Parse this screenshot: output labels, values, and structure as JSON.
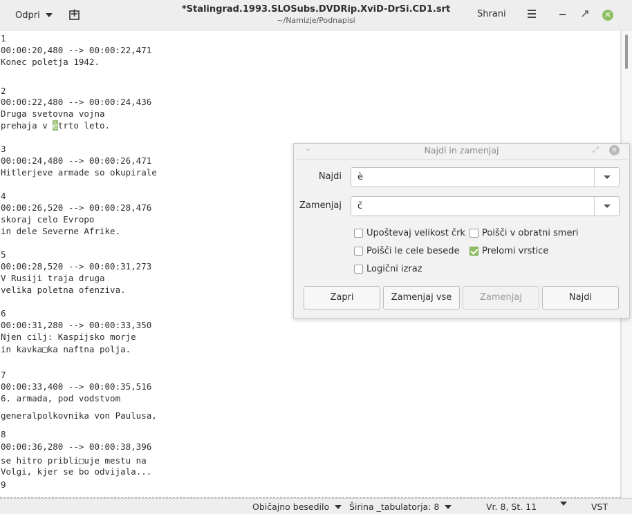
{
  "header": {
    "open_label": "Odpri",
    "title": "*Stalingrad.1993.SLOSubs.DVDRip.XviD-DrSi.CD1.srt",
    "subtitle": "~/Namizje/Podnapisi",
    "save_label": "Shrani",
    "icons": {
      "new_document": "new-document-icon",
      "menu": "hamburger-menu-icon",
      "minimize": "minimize-icon",
      "maximize": "maximize-icon",
      "close": "close-icon"
    }
  },
  "editor": {
    "lines": [
      "1",
      "00:00:20,480 --> 00:00:22,471",
      "Konec poletja 1942.",
      "",
      "2",
      "00:00:22,480 --> 00:00:24,436",
      "Druga svetovna vojna",
      "prehaja v ",
      "",
      "3",
      "00:00:24,480 --> 00:00:26,471",
      "Hitlerjeve armade so okupirale",
      "",
      "4",
      "00:00:26,520 --> 00:00:28,476",
      "skoraj celo Evropo",
      "in dele Severne Afrike.",
      "",
      "5",
      "00:00:28,520 --> 00:00:31,273",
      "V Rusiji traja druga",
      "velika poletna ofenziva.",
      "",
      "6",
      "00:00:31,280 --> 00:00:33,350",
      "Njen cilj: Kaspijsko morje",
      "in kavka",
      "",
      "7",
      "00:00:33,400 --> 00:00:35,516",
      "6. armada, pod vodstvom",
      "generalpolkovnika von Paulusa,",
      "",
      "8",
      "00:00:36,280 --> 00:00:38,396",
      "se hitro pribli",
      "Volgi, kjer se bo odvijala...",
      "",
      "9"
    ],
    "highlight_char": "è",
    "line8_rest": "trto leto.",
    "line27_bad_char": "□",
    "line27_rest": "ka naftna polja.",
    "line36_bad_char": "□",
    "line36_rest": "uje mestu na"
  },
  "statusbar": {
    "language": "Običajno besedilo",
    "tab_width": "Širina _tabulatorja: 8",
    "position": "Vr. 8, St. 11",
    "mode": "VST"
  },
  "dialog": {
    "title": "Najdi in zamenjaj",
    "find_label": "Najdi",
    "find_value": "è",
    "replace_label": "Zamenjaj",
    "replace_value": "č",
    "options": {
      "match_case": {
        "label": "Upoštevaj velikost črk",
        "checked": false
      },
      "search_backwards": {
        "label": "Poišči v obratni smeri",
        "checked": false
      },
      "whole_words": {
        "label": "Poišči le cele besede",
        "checked": false
      },
      "wrap_around": {
        "label": "Prelomi vrstice",
        "checked": true
      },
      "regex": {
        "label": "Logični izraz",
        "checked": false
      }
    },
    "buttons": {
      "close": "Zapri",
      "replace_all": "Zamenjaj vse",
      "replace": "Zamenjaj",
      "find": "Najdi"
    }
  }
}
